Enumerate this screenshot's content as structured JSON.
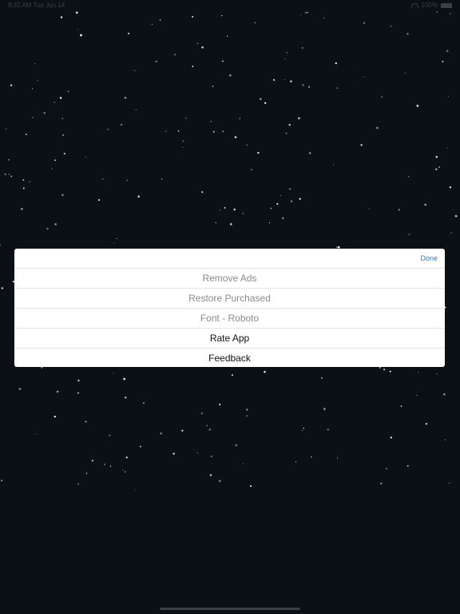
{
  "status_bar": {
    "time_date": "9:32 AM   Tue Jun 14",
    "battery": "100%"
  },
  "sheet": {
    "done_label": "Done",
    "items": [
      {
        "label": "Remove Ads",
        "enabled": false
      },
      {
        "label": "Restore Purchased",
        "enabled": false
      },
      {
        "label": "Font - Roboto",
        "enabled": false
      },
      {
        "label": "Rate App",
        "enabled": true
      },
      {
        "label": "Feedback",
        "enabled": true
      }
    ]
  },
  "colors": {
    "background": "#0b0f16",
    "accent": "#1a7fd8",
    "disabled_text": "#8a8a8a",
    "enabled_text": "#111111"
  }
}
